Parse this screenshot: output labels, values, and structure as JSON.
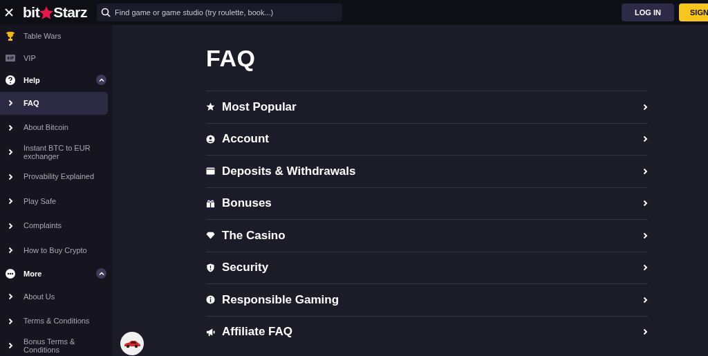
{
  "header": {
    "logo_left": "bit",
    "logo_right": "Starz",
    "search": {
      "placeholder": "Find game or game studio (try roulette, book...)"
    },
    "buttons": [
      {
        "label": "LOG IN",
        "kind": "secondary"
      },
      {
        "label": "SIGN",
        "kind": "primary"
      }
    ]
  },
  "sidebar": {
    "items": [
      {
        "kind": "link",
        "label": "Table Wars",
        "selected": false
      },
      {
        "kind": "link",
        "label": "VIP",
        "selected": false
      },
      {
        "kind": "section",
        "label": "Help",
        "expanded": true,
        "children": [
          {
            "label": "FAQ",
            "selected": true
          },
          {
            "label": "About Bitcoin",
            "selected": false
          },
          {
            "label": "Instant BTC to EUR exchanger",
            "selected": false
          },
          {
            "label": "Provability Explained",
            "selected": false
          },
          {
            "label": "Play Safe",
            "selected": false
          },
          {
            "label": "Complaints",
            "selected": false
          },
          {
            "label": "How to Buy Crypto",
            "selected": false
          }
        ]
      },
      {
        "kind": "section",
        "label": "More",
        "expanded": true,
        "children": [
          {
            "label": "About Us",
            "selected": false
          },
          {
            "label": "Terms & Conditions",
            "selected": false
          },
          {
            "label": "Bonus Terms & Conditions",
            "selected": false
          }
        ]
      }
    ]
  },
  "main": {
    "title": "FAQ",
    "categories": [
      "Most Popular",
      "Account",
      "Deposits & Withdrawals",
      "Bonuses",
      "The Casino",
      "Security",
      "Responsible Gaming",
      "Affiliate FAQ"
    ]
  }
}
